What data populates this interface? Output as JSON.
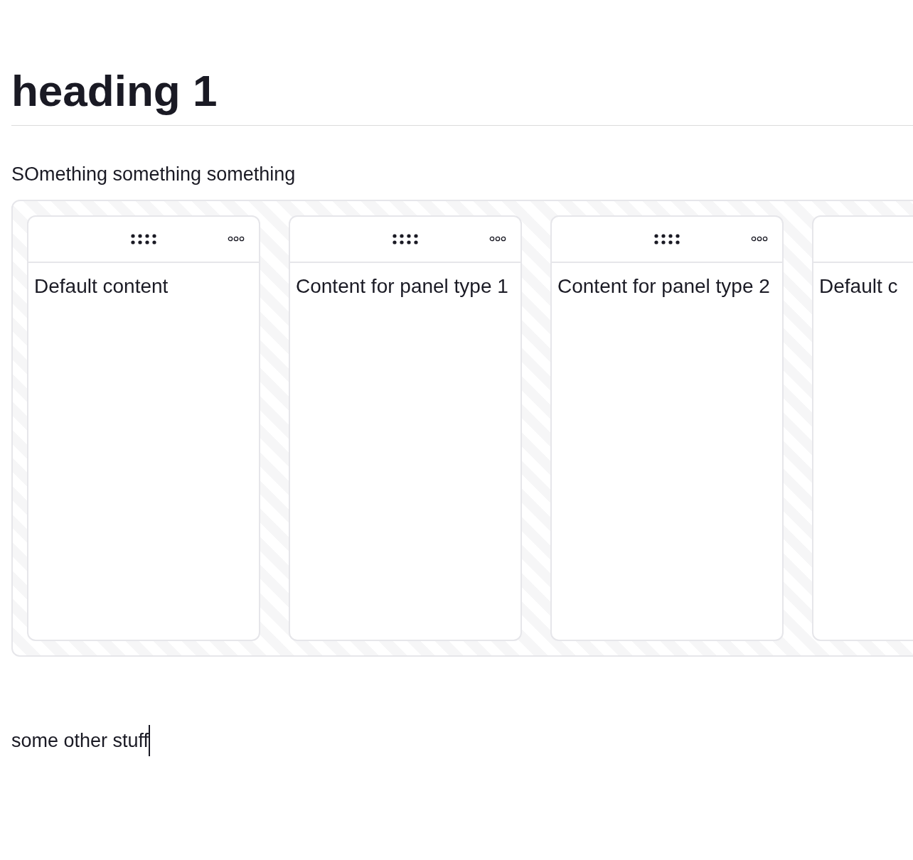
{
  "heading": "heading 1",
  "intro": "SOmething something something",
  "panels": [
    {
      "content": "Default content",
      "controls_visible": true
    },
    {
      "content": "Content for panel type 1",
      "controls_visible": true
    },
    {
      "content": "Content for panel type 2",
      "controls_visible": true
    },
    {
      "content": "Default c"
    }
  ],
  "footer_text": "some other stuff",
  "cursor_visible": true
}
